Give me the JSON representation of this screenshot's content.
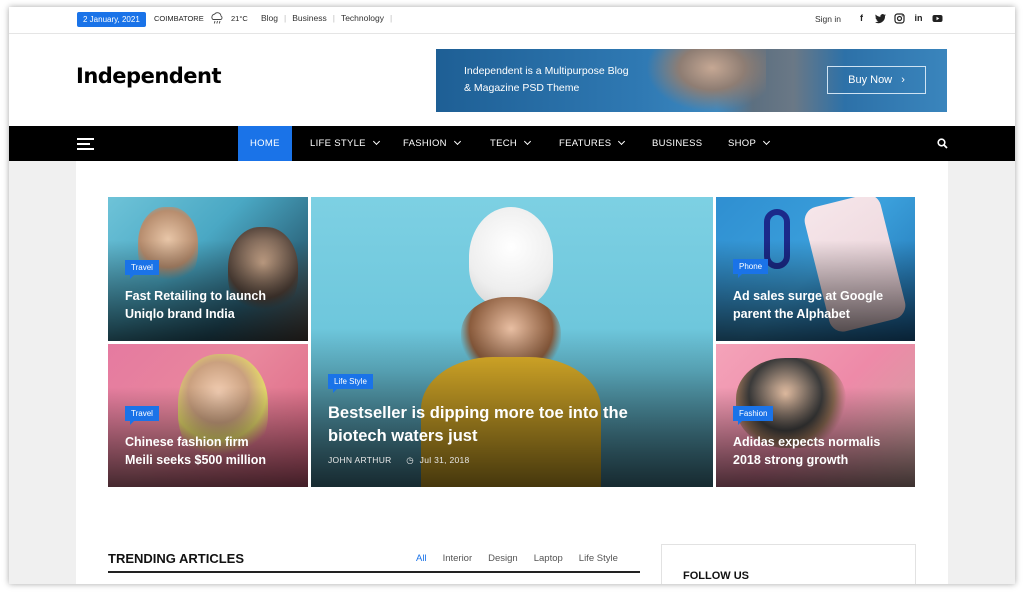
{
  "topbar": {
    "date": "2 January, 2021",
    "city": "COIMBATORE",
    "temperature": "21°C",
    "links": [
      "Blog",
      "Business",
      "Technology"
    ],
    "signin": "Sign in",
    "social_icons": [
      "facebook-icon",
      "twitter-icon",
      "instagram-icon",
      "linkedin-icon",
      "youtube-icon"
    ]
  },
  "header": {
    "logo": "Independent",
    "banner": {
      "line1": "Independent is a Multipurpose Blog",
      "line2": "& Magazine PSD Theme",
      "button": "Buy Now"
    }
  },
  "nav": {
    "items": [
      {
        "label": "HOME",
        "active": true,
        "dropdown": false
      },
      {
        "label": "LIFE STYLE",
        "dropdown": true
      },
      {
        "label": "FASHION",
        "dropdown": true
      },
      {
        "label": "TECH",
        "dropdown": true
      },
      {
        "label": "FEATURES",
        "dropdown": true
      },
      {
        "label": "BUSINESS",
        "dropdown": false
      },
      {
        "label": "SHOP",
        "dropdown": true
      }
    ]
  },
  "featured": {
    "cards": [
      {
        "category": "Travel",
        "title_line1": "Fast Retailing to launch",
        "title_line2": "Uniqlo brand India"
      },
      {
        "category": "Travel",
        "title_line1": "Chinese fashion firm",
        "title_line2": "Meili seeks $500 million"
      },
      {
        "category": "Life Style",
        "title_line1": "Bestseller is dipping more toe into the",
        "title_line2": "biotech waters just",
        "author": "JOHN ARTHUR",
        "date": "Jul 31, 2018"
      },
      {
        "category": "Phone",
        "title_line1": "Ad sales surge at Google",
        "title_line2": "parent the Alphabet"
      },
      {
        "category": "Fashion",
        "title_line1": "Adidas expects normalis",
        "title_line2": "2018 strong growth"
      }
    ]
  },
  "trending": {
    "title": "TRENDING ARTICLES",
    "tabs": [
      "All",
      "Interior",
      "Design",
      "Laptop",
      "Life Style"
    ]
  },
  "sidebar": {
    "follow_title": "FOLLOW US"
  },
  "colors": {
    "accent": "#1a73e8",
    "nav_bg": "#000000"
  }
}
